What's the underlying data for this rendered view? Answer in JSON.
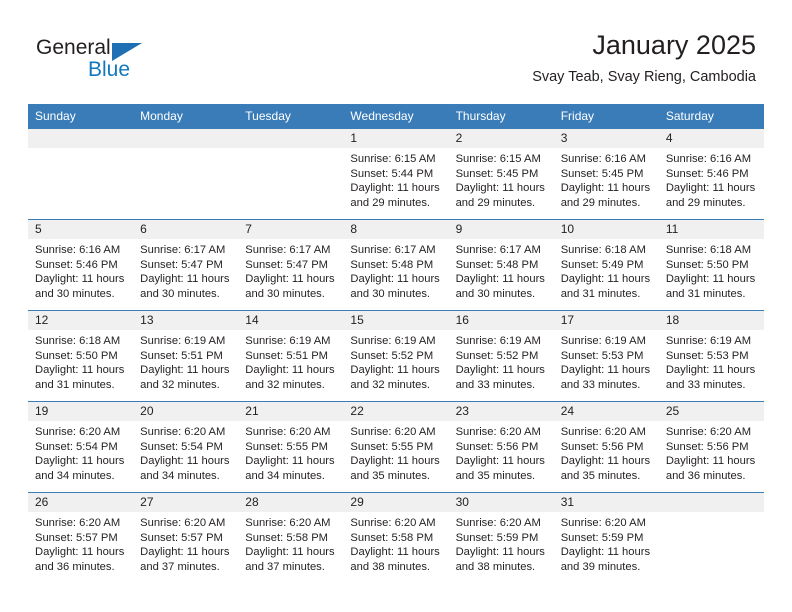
{
  "brand": {
    "name_part1": "General",
    "name_part2": "Blue",
    "color_dark": "#231f20",
    "color_blue": "#1278be",
    "triangle_color": "#1f6fb5"
  },
  "header": {
    "title": "January 2025",
    "subtitle": "Svay Teab, Svay Rieng, Cambodia"
  },
  "theme": {
    "header_bg": "#3a7cb8",
    "daynum_bg": "#f0f0f0",
    "text": "#231f20"
  },
  "weekdays": [
    "Sunday",
    "Monday",
    "Tuesday",
    "Wednesday",
    "Thursday",
    "Friday",
    "Saturday"
  ],
  "weeks": [
    [
      {
        "day": "",
        "sunrise": "",
        "sunset": "",
        "daylight": ""
      },
      {
        "day": "",
        "sunrise": "",
        "sunset": "",
        "daylight": ""
      },
      {
        "day": "",
        "sunrise": "",
        "sunset": "",
        "daylight": ""
      },
      {
        "day": "1",
        "sunrise": "Sunrise: 6:15 AM",
        "sunset": "Sunset: 5:44 PM",
        "daylight": "Daylight: 11 hours and 29 minutes."
      },
      {
        "day": "2",
        "sunrise": "Sunrise: 6:15 AM",
        "sunset": "Sunset: 5:45 PM",
        "daylight": "Daylight: 11 hours and 29 minutes."
      },
      {
        "day": "3",
        "sunrise": "Sunrise: 6:16 AM",
        "sunset": "Sunset: 5:45 PM",
        "daylight": "Daylight: 11 hours and 29 minutes."
      },
      {
        "day": "4",
        "sunrise": "Sunrise: 6:16 AM",
        "sunset": "Sunset: 5:46 PM",
        "daylight": "Daylight: 11 hours and 29 minutes."
      }
    ],
    [
      {
        "day": "5",
        "sunrise": "Sunrise: 6:16 AM",
        "sunset": "Sunset: 5:46 PM",
        "daylight": "Daylight: 11 hours and 30 minutes."
      },
      {
        "day": "6",
        "sunrise": "Sunrise: 6:17 AM",
        "sunset": "Sunset: 5:47 PM",
        "daylight": "Daylight: 11 hours and 30 minutes."
      },
      {
        "day": "7",
        "sunrise": "Sunrise: 6:17 AM",
        "sunset": "Sunset: 5:47 PM",
        "daylight": "Daylight: 11 hours and 30 minutes."
      },
      {
        "day": "8",
        "sunrise": "Sunrise: 6:17 AM",
        "sunset": "Sunset: 5:48 PM",
        "daylight": "Daylight: 11 hours and 30 minutes."
      },
      {
        "day": "9",
        "sunrise": "Sunrise: 6:17 AM",
        "sunset": "Sunset: 5:48 PM",
        "daylight": "Daylight: 11 hours and 30 minutes."
      },
      {
        "day": "10",
        "sunrise": "Sunrise: 6:18 AM",
        "sunset": "Sunset: 5:49 PM",
        "daylight": "Daylight: 11 hours and 31 minutes."
      },
      {
        "day": "11",
        "sunrise": "Sunrise: 6:18 AM",
        "sunset": "Sunset: 5:50 PM",
        "daylight": "Daylight: 11 hours and 31 minutes."
      }
    ],
    [
      {
        "day": "12",
        "sunrise": "Sunrise: 6:18 AM",
        "sunset": "Sunset: 5:50 PM",
        "daylight": "Daylight: 11 hours and 31 minutes."
      },
      {
        "day": "13",
        "sunrise": "Sunrise: 6:19 AM",
        "sunset": "Sunset: 5:51 PM",
        "daylight": "Daylight: 11 hours and 32 minutes."
      },
      {
        "day": "14",
        "sunrise": "Sunrise: 6:19 AM",
        "sunset": "Sunset: 5:51 PM",
        "daylight": "Daylight: 11 hours and 32 minutes."
      },
      {
        "day": "15",
        "sunrise": "Sunrise: 6:19 AM",
        "sunset": "Sunset: 5:52 PM",
        "daylight": "Daylight: 11 hours and 32 minutes."
      },
      {
        "day": "16",
        "sunrise": "Sunrise: 6:19 AM",
        "sunset": "Sunset: 5:52 PM",
        "daylight": "Daylight: 11 hours and 33 minutes."
      },
      {
        "day": "17",
        "sunrise": "Sunrise: 6:19 AM",
        "sunset": "Sunset: 5:53 PM",
        "daylight": "Daylight: 11 hours and 33 minutes."
      },
      {
        "day": "18",
        "sunrise": "Sunrise: 6:19 AM",
        "sunset": "Sunset: 5:53 PM",
        "daylight": "Daylight: 11 hours and 33 minutes."
      }
    ],
    [
      {
        "day": "19",
        "sunrise": "Sunrise: 6:20 AM",
        "sunset": "Sunset: 5:54 PM",
        "daylight": "Daylight: 11 hours and 34 minutes."
      },
      {
        "day": "20",
        "sunrise": "Sunrise: 6:20 AM",
        "sunset": "Sunset: 5:54 PM",
        "daylight": "Daylight: 11 hours and 34 minutes."
      },
      {
        "day": "21",
        "sunrise": "Sunrise: 6:20 AM",
        "sunset": "Sunset: 5:55 PM",
        "daylight": "Daylight: 11 hours and 34 minutes."
      },
      {
        "day": "22",
        "sunrise": "Sunrise: 6:20 AM",
        "sunset": "Sunset: 5:55 PM",
        "daylight": "Daylight: 11 hours and 35 minutes."
      },
      {
        "day": "23",
        "sunrise": "Sunrise: 6:20 AM",
        "sunset": "Sunset: 5:56 PM",
        "daylight": "Daylight: 11 hours and 35 minutes."
      },
      {
        "day": "24",
        "sunrise": "Sunrise: 6:20 AM",
        "sunset": "Sunset: 5:56 PM",
        "daylight": "Daylight: 11 hours and 35 minutes."
      },
      {
        "day": "25",
        "sunrise": "Sunrise: 6:20 AM",
        "sunset": "Sunset: 5:56 PM",
        "daylight": "Daylight: 11 hours and 36 minutes."
      }
    ],
    [
      {
        "day": "26",
        "sunrise": "Sunrise: 6:20 AM",
        "sunset": "Sunset: 5:57 PM",
        "daylight": "Daylight: 11 hours and 36 minutes."
      },
      {
        "day": "27",
        "sunrise": "Sunrise: 6:20 AM",
        "sunset": "Sunset: 5:57 PM",
        "daylight": "Daylight: 11 hours and 37 minutes."
      },
      {
        "day": "28",
        "sunrise": "Sunrise: 6:20 AM",
        "sunset": "Sunset: 5:58 PM",
        "daylight": "Daylight: 11 hours and 37 minutes."
      },
      {
        "day": "29",
        "sunrise": "Sunrise: 6:20 AM",
        "sunset": "Sunset: 5:58 PM",
        "daylight": "Daylight: 11 hours and 38 minutes."
      },
      {
        "day": "30",
        "sunrise": "Sunrise: 6:20 AM",
        "sunset": "Sunset: 5:59 PM",
        "daylight": "Daylight: 11 hours and 38 minutes."
      },
      {
        "day": "31",
        "sunrise": "Sunrise: 6:20 AM",
        "sunset": "Sunset: 5:59 PM",
        "daylight": "Daylight: 11 hours and 39 minutes."
      },
      {
        "day": "",
        "sunrise": "",
        "sunset": "",
        "daylight": ""
      }
    ]
  ]
}
